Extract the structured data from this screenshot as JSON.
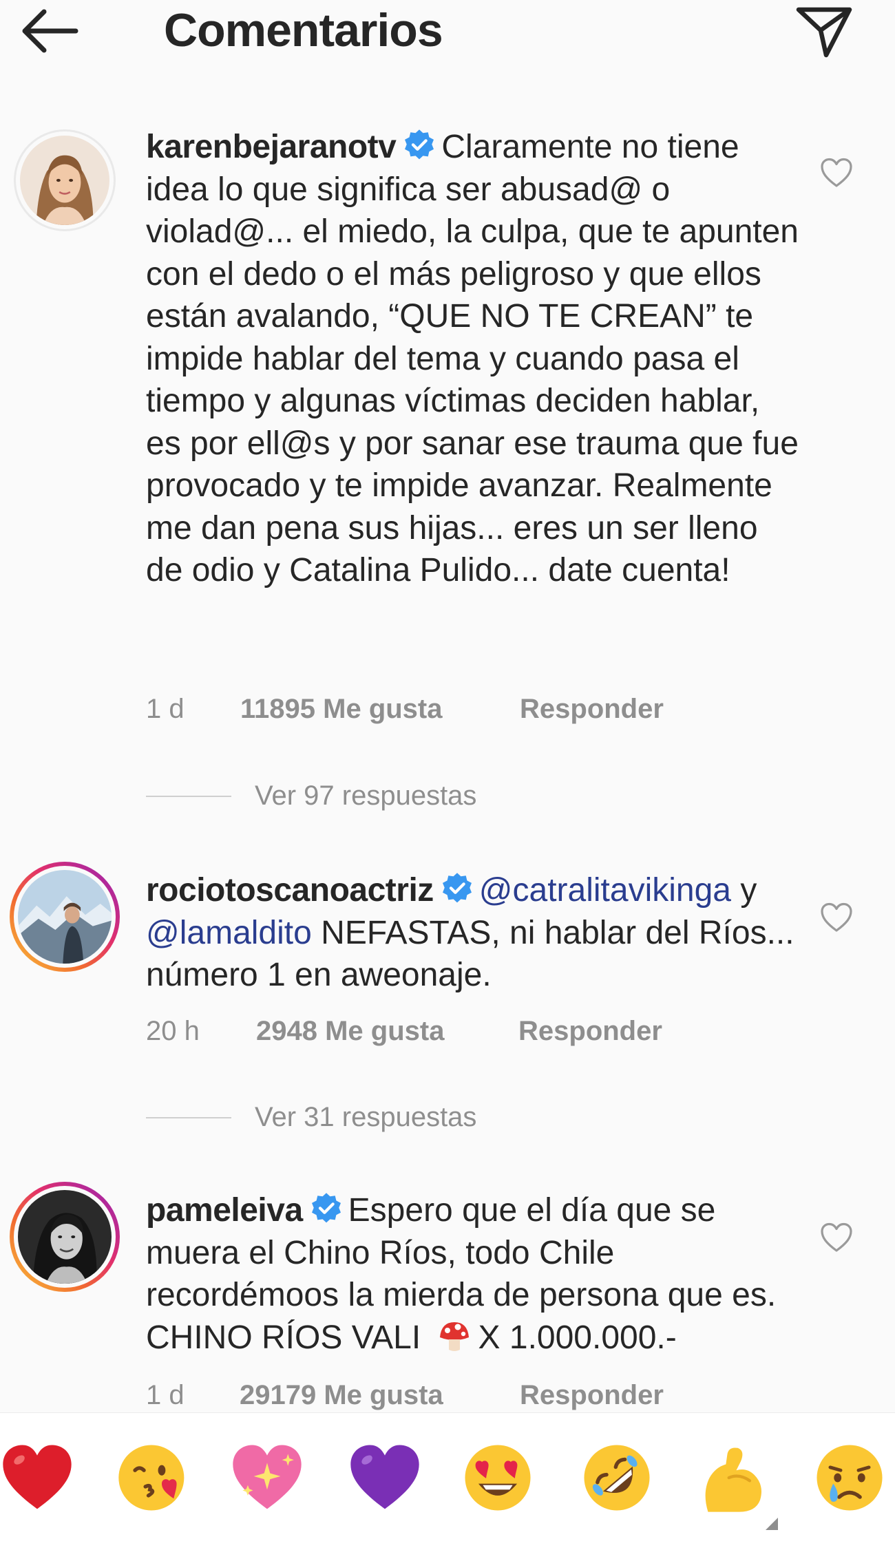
{
  "header": {
    "title": "Comentarios",
    "back_icon": "arrow-left-icon",
    "share_icon": "send-icon"
  },
  "comments": [
    {
      "username": "karenbejaranotv",
      "verified": true,
      "text": "Claramente no tiene idea lo que significa ser abusad@ o violad@... el miedo, la culpa, que te apunten con el dedo o el más peligroso y que ellos están avalando, “QUE NO TE CREAN” te impide hablar del tema y cuando pasa el tiempo y algunas víctimas deciden hablar, es por ell@s y por sanar ese trauma que fue provocado y te impide avanzar. Realmente me dan pena sus hijas... eres un ser lleno de odio y Catalina Pulido... date cuenta!",
      "time": "1 d",
      "likes": "11895 Me gusta",
      "reply": "Responder",
      "view_replies": "Ver 97 respuestas"
    },
    {
      "username": "rociotoscanoactriz",
      "verified": true,
      "mention_1": "@catralitavikinga",
      "connector": "y",
      "mention_2": "@lamaldito",
      "text": "NEFASTAS, ni hablar del Ríos... número 1 en aweonaje.",
      "time": "20 h",
      "likes": "2948 Me gusta",
      "reply": "Responder",
      "view_replies": "Ver 31 respuestas"
    },
    {
      "username": "pameleiva",
      "verified": true,
      "text": "Espero que el día que se muera el Chino Ríos, todo Chile recordémoos la mierda de persona que es. CHINO RÍOS VALI",
      "emoji": "mushroom",
      "text_after": "X 1.000.000.-",
      "time": "1 d",
      "likes": "29179 Me gusta",
      "reply": "Responder"
    }
  ],
  "reaction_bar": {
    "emojis": [
      "red-heart",
      "face-blowing-kiss",
      "sparkling-heart",
      "purple-heart",
      "heart-eyes",
      "rolling-on-floor-laughing",
      "flexed-biceps",
      "crying-face"
    ]
  },
  "colors": {
    "background": "#fafafa",
    "text": "#262626",
    "secondary": "#8e8e8e",
    "mention": "#2a3d8f",
    "verified": "#3897f0"
  }
}
